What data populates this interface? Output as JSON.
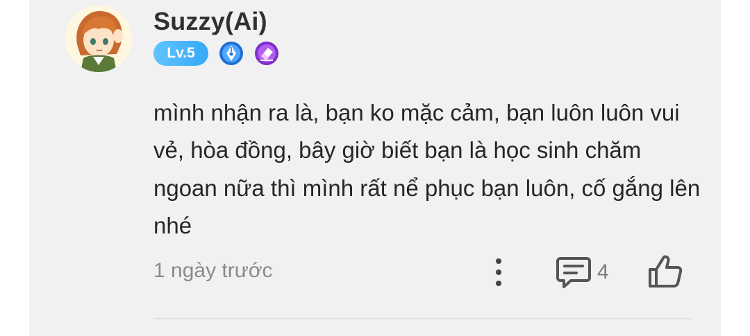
{
  "comment": {
    "username": "Suzzy(Ai)",
    "level": "Lv.5",
    "badges": [
      "pen-nib-badge-icon",
      "eraser-badge-icon"
    ],
    "text": "mình nhận ra là, bạn ko mặc cảm, bạn luôn luôn vui vẻ, hòa đồng, bây giờ biết bạn là học sinh chăm ngoan nữa thì mình rất nể phục bạn luôn, cố gắng lên nhé",
    "time": "1 ngày trước",
    "reply_count": "4"
  },
  "colors": {
    "card_bg": "#f1f1f1",
    "level_badge": "#4bb8fb",
    "text": "#262626",
    "muted": "#8a8a8a"
  }
}
